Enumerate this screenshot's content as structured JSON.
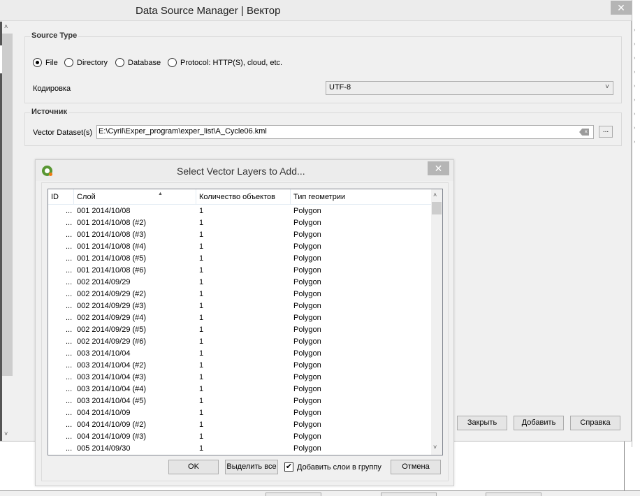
{
  "main_dialog": {
    "title": "Data Source Manager | Вектор",
    "close_glyph": "✕",
    "source_type": {
      "label": "Source Type",
      "options": [
        {
          "label": "File",
          "selected": true
        },
        {
          "label": "Directory",
          "selected": false
        },
        {
          "label": "Database",
          "selected": false
        },
        {
          "label": "Protocol: HTTP(S), cloud, etc.",
          "selected": false
        }
      ],
      "encoding_label": "Кодировка",
      "encoding_value": "UTF-8"
    },
    "source": {
      "label": "Источник",
      "dataset_label": "Vector Dataset(s)",
      "dataset_value": "E:\\Cyril\\Exper_program\\exper_list\\A_Cycle06.kml",
      "browse_label": "..."
    },
    "buttons": {
      "close": "Закрыть",
      "add": "Добавить",
      "help": "Справка"
    }
  },
  "layer_dialog": {
    "title": "Select Vector Layers to Add...",
    "close_glyph": "✕",
    "columns": [
      "ID",
      "Слой",
      "Количество объектов",
      "Тип геометрии"
    ],
    "rows": [
      {
        "id": "...",
        "layer": "001 2014/10/08",
        "count": "1",
        "geometry": "Polygon"
      },
      {
        "id": "...",
        "layer": "001 2014/10/08 (#2)",
        "count": "1",
        "geometry": "Polygon"
      },
      {
        "id": "...",
        "layer": "001 2014/10/08 (#3)",
        "count": "1",
        "geometry": "Polygon"
      },
      {
        "id": "...",
        "layer": "001 2014/10/08 (#4)",
        "count": "1",
        "geometry": "Polygon"
      },
      {
        "id": "...",
        "layer": "001 2014/10/08 (#5)",
        "count": "1",
        "geometry": "Polygon"
      },
      {
        "id": "...",
        "layer": "001 2014/10/08 (#6)",
        "count": "1",
        "geometry": "Polygon"
      },
      {
        "id": "...",
        "layer": "002 2014/09/29",
        "count": "1",
        "geometry": "Polygon"
      },
      {
        "id": "...",
        "layer": "002 2014/09/29 (#2)",
        "count": "1",
        "geometry": "Polygon"
      },
      {
        "id": "...",
        "layer": "002 2014/09/29 (#3)",
        "count": "1",
        "geometry": "Polygon"
      },
      {
        "id": "...",
        "layer": "002 2014/09/29 (#4)",
        "count": "1",
        "geometry": "Polygon"
      },
      {
        "id": "...",
        "layer": "002 2014/09/29 (#5)",
        "count": "1",
        "geometry": "Polygon"
      },
      {
        "id": "...",
        "layer": "002 2014/09/29 (#6)",
        "count": "1",
        "geometry": "Polygon"
      },
      {
        "id": "...",
        "layer": "003 2014/10/04",
        "count": "1",
        "geometry": "Polygon"
      },
      {
        "id": "...",
        "layer": "003 2014/10/04 (#2)",
        "count": "1",
        "geometry": "Polygon"
      },
      {
        "id": "...",
        "layer": "003 2014/10/04 (#3)",
        "count": "1",
        "geometry": "Polygon"
      },
      {
        "id": "...",
        "layer": "003 2014/10/04 (#4)",
        "count": "1",
        "geometry": "Polygon"
      },
      {
        "id": "...",
        "layer": "003 2014/10/04 (#5)",
        "count": "1",
        "geometry": "Polygon"
      },
      {
        "id": "...",
        "layer": "004 2014/10/09",
        "count": "1",
        "geometry": "Polygon"
      },
      {
        "id": "...",
        "layer": "004 2014/10/09 (#2)",
        "count": "1",
        "geometry": "Polygon"
      },
      {
        "id": "...",
        "layer": "004 2014/10/09 (#3)",
        "count": "1",
        "geometry": "Polygon"
      },
      {
        "id": "...",
        "layer": "005 2014/09/30",
        "count": "1",
        "geometry": "Polygon"
      }
    ],
    "buttons": {
      "ok": "OK",
      "select_all": "Выделить все",
      "add_to_group": "Добавить слои в группу",
      "add_to_group_checked": true,
      "cancel": "Отмена"
    }
  },
  "icons": {
    "scroll_up": "˄",
    "scroll_down": "˅",
    "combo_chevron": "˅",
    "check_mark": "✔",
    "sort_ascending": "▲"
  }
}
